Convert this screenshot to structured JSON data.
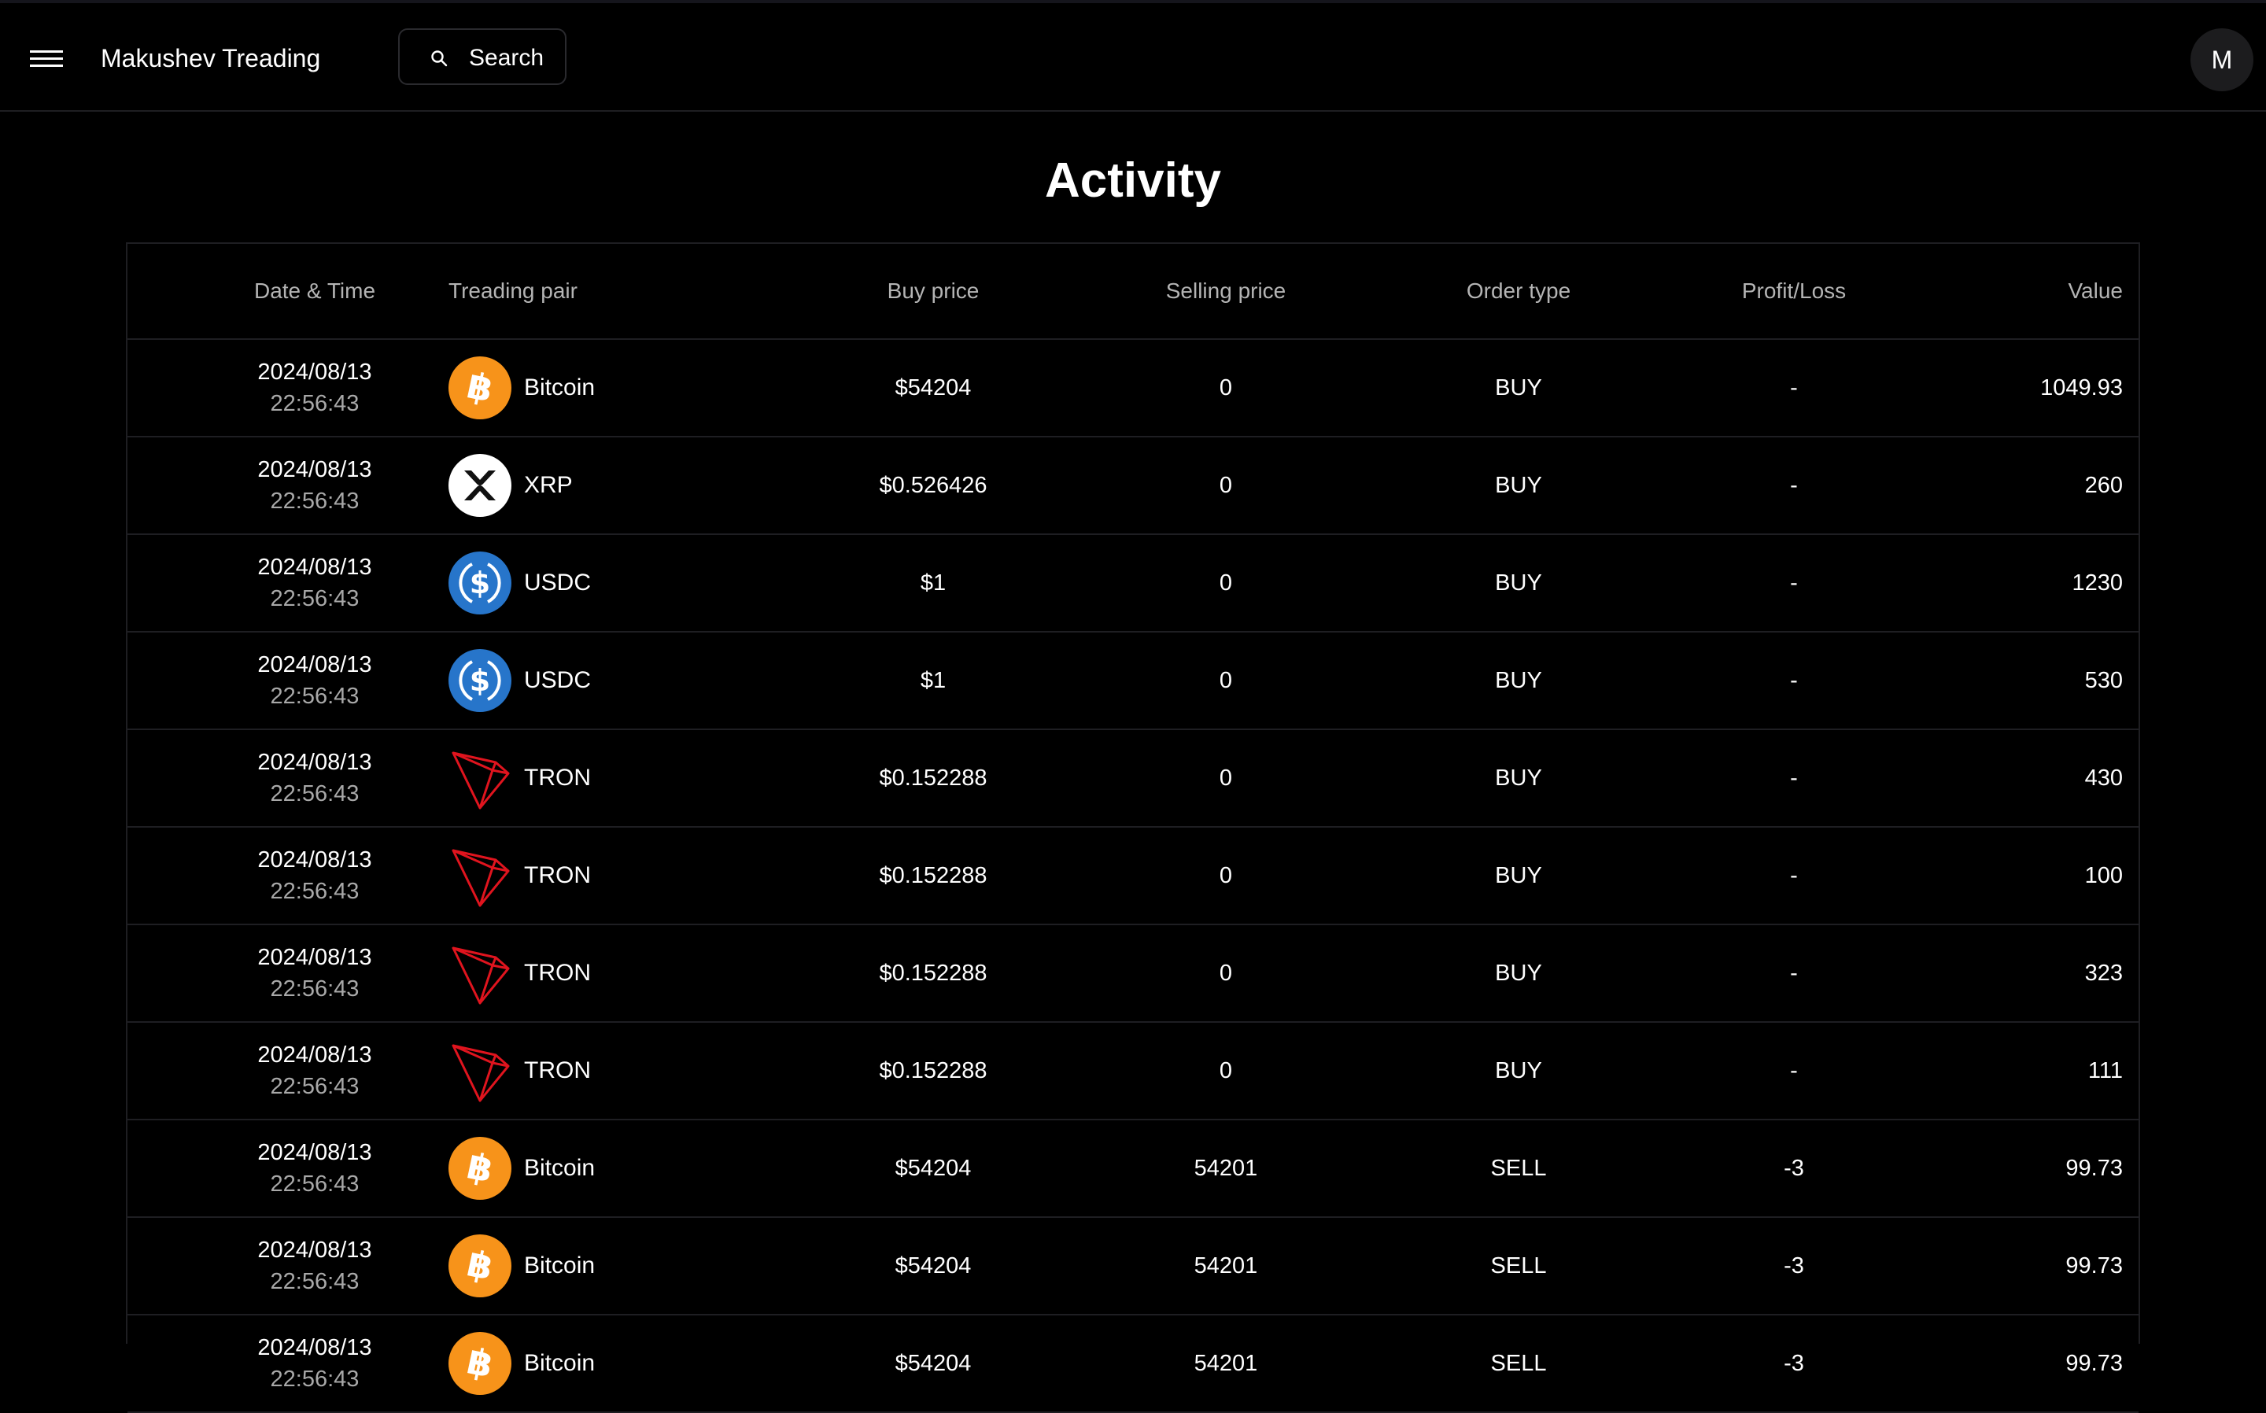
{
  "app": {
    "brand": "Makushev Treading",
    "search_label": "Search",
    "avatar_initial": "M"
  },
  "page": {
    "title": "Activity"
  },
  "table": {
    "headers": {
      "date": "Date & Time",
      "pair": "Treading pair",
      "buy": "Buy price",
      "sell": "Selling price",
      "type": "Order type",
      "pl": "Profit/Loss",
      "value": "Value"
    },
    "rows": [
      {
        "date": "2024/08/13",
        "time": "22:56:43",
        "coin": "Bitcoin",
        "icon": "bitcoin-icon",
        "buy": "$54204",
        "sell": "0",
        "type": "BUY",
        "pl": "-",
        "value": "1049.93"
      },
      {
        "date": "2024/08/13",
        "time": "22:56:43",
        "coin": "XRP",
        "icon": "xrp-icon",
        "buy": "$0.526426",
        "sell": "0",
        "type": "BUY",
        "pl": "-",
        "value": "260"
      },
      {
        "date": "2024/08/13",
        "time": "22:56:43",
        "coin": "USDC",
        "icon": "usdc-icon",
        "buy": "$1",
        "sell": "0",
        "type": "BUY",
        "pl": "-",
        "value": "1230"
      },
      {
        "date": "2024/08/13",
        "time": "22:56:43",
        "coin": "USDC",
        "icon": "usdc-icon",
        "buy": "$1",
        "sell": "0",
        "type": "BUY",
        "pl": "-",
        "value": "530"
      },
      {
        "date": "2024/08/13",
        "time": "22:56:43",
        "coin": "TRON",
        "icon": "tron-icon",
        "buy": "$0.152288",
        "sell": "0",
        "type": "BUY",
        "pl": "-",
        "value": "430"
      },
      {
        "date": "2024/08/13",
        "time": "22:56:43",
        "coin": "TRON",
        "icon": "tron-icon",
        "buy": "$0.152288",
        "sell": "0",
        "type": "BUY",
        "pl": "-",
        "value": "100"
      },
      {
        "date": "2024/08/13",
        "time": "22:56:43",
        "coin": "TRON",
        "icon": "tron-icon",
        "buy": "$0.152288",
        "sell": "0",
        "type": "BUY",
        "pl": "-",
        "value": "323"
      },
      {
        "date": "2024/08/13",
        "time": "22:56:43",
        "coin": "TRON",
        "icon": "tron-icon",
        "buy": "$0.152288",
        "sell": "0",
        "type": "BUY",
        "pl": "-",
        "value": "111"
      },
      {
        "date": "2024/08/13",
        "time": "22:56:43",
        "coin": "Bitcoin",
        "icon": "bitcoin-icon",
        "buy": "$54204",
        "sell": "54201",
        "type": "SELL",
        "pl": "-3",
        "value": "99.73"
      },
      {
        "date": "2024/08/13",
        "time": "22:56:43",
        "coin": "Bitcoin",
        "icon": "bitcoin-icon",
        "buy": "$54204",
        "sell": "54201",
        "type": "SELL",
        "pl": "-3",
        "value": "99.73"
      },
      {
        "date": "2024/08/13",
        "time": "22:56:43",
        "coin": "Bitcoin",
        "icon": "bitcoin-icon",
        "buy": "$54204",
        "sell": "54201",
        "type": "SELL",
        "pl": "-3",
        "value": "99.73"
      }
    ]
  },
  "colors": {
    "background": "#000000",
    "border": "#1e1e22",
    "bitcoin": "#f7931a",
    "usdc": "#2775ca",
    "tron": "#e0141e"
  }
}
